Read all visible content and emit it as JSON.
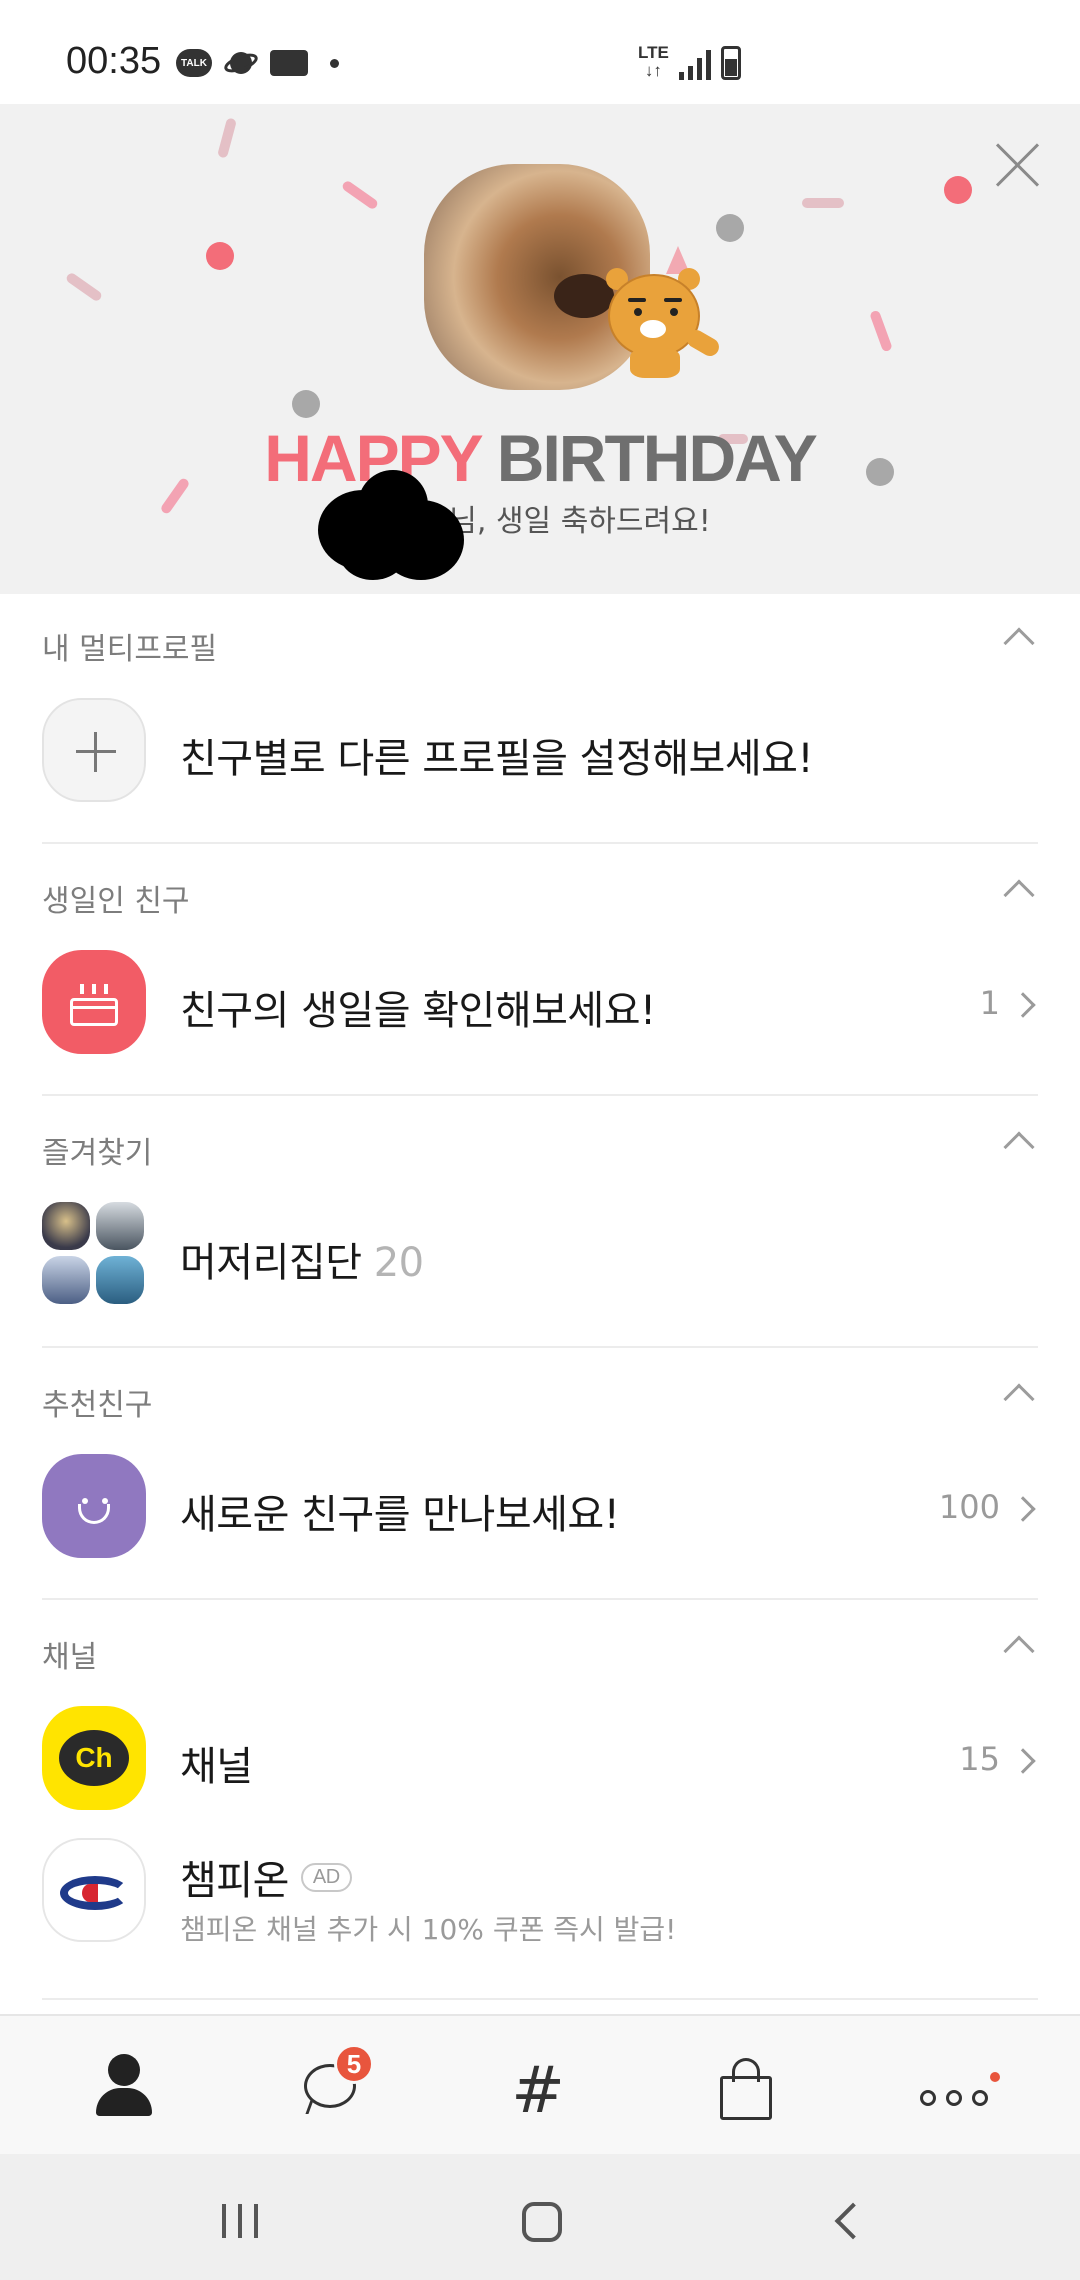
{
  "status": {
    "time": "00:35",
    "talk": "TALK",
    "network": "LTE"
  },
  "banner": {
    "title_pink": "HAPPY",
    "title_gray": "BIRTHDAY",
    "subtitle": "님, 생일 축하드려요!"
  },
  "sections": {
    "multiprofile": {
      "title": "내 멀티프로필",
      "label": "친구별로 다른 프로필을 설정해보세요!"
    },
    "birthday": {
      "title": "생일인 친구",
      "label": "친구의 생일을 확인해보세요!",
      "count": "1"
    },
    "favorites": {
      "title": "즐겨찾기",
      "label": "머저리집단",
      "count": "20"
    },
    "recommended": {
      "title": "추천친구",
      "label": "새로운 친구를 만나보세요!",
      "count": "100"
    },
    "channel": {
      "title": "채널",
      "label": "채널",
      "count": "15",
      "ad_name": "챔피온",
      "ad_badge": "AD",
      "ad_desc": "챔피온 채널 추가 시 10% 쿠폰 즉시 발급!",
      "ch_text": "Ch"
    }
  },
  "tabbar": {
    "chat_badge": "5",
    "hash": "#"
  },
  "colors": {
    "accent_pink": "#f36d79",
    "birthday_red": "#f25c66",
    "recommend_purple": "#9078c0",
    "kakao_yellow": "#ffe400",
    "badge_orange": "#e8553d"
  },
  "icons": [
    "talk-icon",
    "planet-icon",
    "card-icon",
    "signal-icon",
    "battery-icon",
    "close-icon",
    "plus-icon",
    "cake-icon",
    "smile-icon",
    "channel-icon",
    "champion-logo-icon",
    "chevron-up-icon",
    "chevron-right-icon",
    "friends-icon",
    "chat-icon",
    "hashtag-icon",
    "shopping-icon",
    "more-icon"
  ]
}
